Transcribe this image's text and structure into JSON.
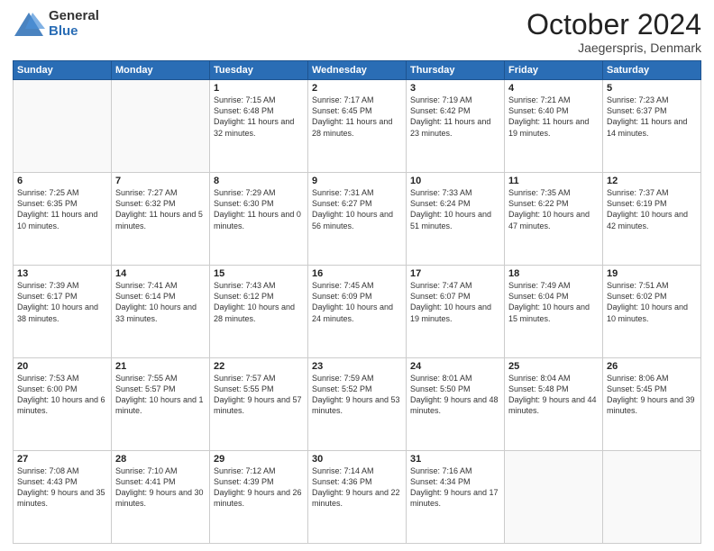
{
  "logo": {
    "general": "General",
    "blue": "Blue"
  },
  "header": {
    "month": "October 2024",
    "location": "Jaegerspris, Denmark"
  },
  "weekdays": [
    "Sunday",
    "Monday",
    "Tuesday",
    "Wednesday",
    "Thursday",
    "Friday",
    "Saturday"
  ],
  "weeks": [
    [
      {
        "day": "",
        "sunrise": "",
        "sunset": "",
        "daylight": ""
      },
      {
        "day": "",
        "sunrise": "",
        "sunset": "",
        "daylight": ""
      },
      {
        "day": "1",
        "sunrise": "Sunrise: 7:15 AM",
        "sunset": "Sunset: 6:48 PM",
        "daylight": "Daylight: 11 hours and 32 minutes."
      },
      {
        "day": "2",
        "sunrise": "Sunrise: 7:17 AM",
        "sunset": "Sunset: 6:45 PM",
        "daylight": "Daylight: 11 hours and 28 minutes."
      },
      {
        "day": "3",
        "sunrise": "Sunrise: 7:19 AM",
        "sunset": "Sunset: 6:42 PM",
        "daylight": "Daylight: 11 hours and 23 minutes."
      },
      {
        "day": "4",
        "sunrise": "Sunrise: 7:21 AM",
        "sunset": "Sunset: 6:40 PM",
        "daylight": "Daylight: 11 hours and 19 minutes."
      },
      {
        "day": "5",
        "sunrise": "Sunrise: 7:23 AM",
        "sunset": "Sunset: 6:37 PM",
        "daylight": "Daylight: 11 hours and 14 minutes."
      }
    ],
    [
      {
        "day": "6",
        "sunrise": "Sunrise: 7:25 AM",
        "sunset": "Sunset: 6:35 PM",
        "daylight": "Daylight: 11 hours and 10 minutes."
      },
      {
        "day": "7",
        "sunrise": "Sunrise: 7:27 AM",
        "sunset": "Sunset: 6:32 PM",
        "daylight": "Daylight: 11 hours and 5 minutes."
      },
      {
        "day": "8",
        "sunrise": "Sunrise: 7:29 AM",
        "sunset": "Sunset: 6:30 PM",
        "daylight": "Daylight: 11 hours and 0 minutes."
      },
      {
        "day": "9",
        "sunrise": "Sunrise: 7:31 AM",
        "sunset": "Sunset: 6:27 PM",
        "daylight": "Daylight: 10 hours and 56 minutes."
      },
      {
        "day": "10",
        "sunrise": "Sunrise: 7:33 AM",
        "sunset": "Sunset: 6:24 PM",
        "daylight": "Daylight: 10 hours and 51 minutes."
      },
      {
        "day": "11",
        "sunrise": "Sunrise: 7:35 AM",
        "sunset": "Sunset: 6:22 PM",
        "daylight": "Daylight: 10 hours and 47 minutes."
      },
      {
        "day": "12",
        "sunrise": "Sunrise: 7:37 AM",
        "sunset": "Sunset: 6:19 PM",
        "daylight": "Daylight: 10 hours and 42 minutes."
      }
    ],
    [
      {
        "day": "13",
        "sunrise": "Sunrise: 7:39 AM",
        "sunset": "Sunset: 6:17 PM",
        "daylight": "Daylight: 10 hours and 38 minutes."
      },
      {
        "day": "14",
        "sunrise": "Sunrise: 7:41 AM",
        "sunset": "Sunset: 6:14 PM",
        "daylight": "Daylight: 10 hours and 33 minutes."
      },
      {
        "day": "15",
        "sunrise": "Sunrise: 7:43 AM",
        "sunset": "Sunset: 6:12 PM",
        "daylight": "Daylight: 10 hours and 28 minutes."
      },
      {
        "day": "16",
        "sunrise": "Sunrise: 7:45 AM",
        "sunset": "Sunset: 6:09 PM",
        "daylight": "Daylight: 10 hours and 24 minutes."
      },
      {
        "day": "17",
        "sunrise": "Sunrise: 7:47 AM",
        "sunset": "Sunset: 6:07 PM",
        "daylight": "Daylight: 10 hours and 19 minutes."
      },
      {
        "day": "18",
        "sunrise": "Sunrise: 7:49 AM",
        "sunset": "Sunset: 6:04 PM",
        "daylight": "Daylight: 10 hours and 15 minutes."
      },
      {
        "day": "19",
        "sunrise": "Sunrise: 7:51 AM",
        "sunset": "Sunset: 6:02 PM",
        "daylight": "Daylight: 10 hours and 10 minutes."
      }
    ],
    [
      {
        "day": "20",
        "sunrise": "Sunrise: 7:53 AM",
        "sunset": "Sunset: 6:00 PM",
        "daylight": "Daylight: 10 hours and 6 minutes."
      },
      {
        "day": "21",
        "sunrise": "Sunrise: 7:55 AM",
        "sunset": "Sunset: 5:57 PM",
        "daylight": "Daylight: 10 hours and 1 minute."
      },
      {
        "day": "22",
        "sunrise": "Sunrise: 7:57 AM",
        "sunset": "Sunset: 5:55 PM",
        "daylight": "Daylight: 9 hours and 57 minutes."
      },
      {
        "day": "23",
        "sunrise": "Sunrise: 7:59 AM",
        "sunset": "Sunset: 5:52 PM",
        "daylight": "Daylight: 9 hours and 53 minutes."
      },
      {
        "day": "24",
        "sunrise": "Sunrise: 8:01 AM",
        "sunset": "Sunset: 5:50 PM",
        "daylight": "Daylight: 9 hours and 48 minutes."
      },
      {
        "day": "25",
        "sunrise": "Sunrise: 8:04 AM",
        "sunset": "Sunset: 5:48 PM",
        "daylight": "Daylight: 9 hours and 44 minutes."
      },
      {
        "day": "26",
        "sunrise": "Sunrise: 8:06 AM",
        "sunset": "Sunset: 5:45 PM",
        "daylight": "Daylight: 9 hours and 39 minutes."
      }
    ],
    [
      {
        "day": "27",
        "sunrise": "Sunrise: 7:08 AM",
        "sunset": "Sunset: 4:43 PM",
        "daylight": "Daylight: 9 hours and 35 minutes."
      },
      {
        "day": "28",
        "sunrise": "Sunrise: 7:10 AM",
        "sunset": "Sunset: 4:41 PM",
        "daylight": "Daylight: 9 hours and 30 minutes."
      },
      {
        "day": "29",
        "sunrise": "Sunrise: 7:12 AM",
        "sunset": "Sunset: 4:39 PM",
        "daylight": "Daylight: 9 hours and 26 minutes."
      },
      {
        "day": "30",
        "sunrise": "Sunrise: 7:14 AM",
        "sunset": "Sunset: 4:36 PM",
        "daylight": "Daylight: 9 hours and 22 minutes."
      },
      {
        "day": "31",
        "sunrise": "Sunrise: 7:16 AM",
        "sunset": "Sunset: 4:34 PM",
        "daylight": "Daylight: 9 hours and 17 minutes."
      },
      {
        "day": "",
        "sunrise": "",
        "sunset": "",
        "daylight": ""
      },
      {
        "day": "",
        "sunrise": "",
        "sunset": "",
        "daylight": ""
      }
    ]
  ]
}
